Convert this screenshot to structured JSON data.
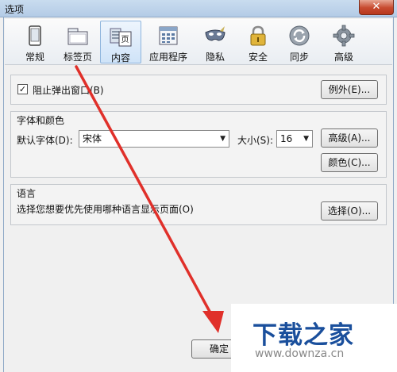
{
  "window": {
    "title": "选项",
    "close_label": "✕"
  },
  "tabs": [
    {
      "label": "常规",
      "icon": "general-icon",
      "selected": false
    },
    {
      "label": "标签页",
      "icon": "tabs-icon",
      "selected": false
    },
    {
      "label": "内容",
      "icon": "content-icon",
      "selected": true,
      "icon_text": "页"
    },
    {
      "label": "应用程序",
      "icon": "applications-icon",
      "selected": false
    },
    {
      "label": "隐私",
      "icon": "privacy-mask-icon",
      "selected": false
    },
    {
      "label": "安全",
      "icon": "security-lock-icon",
      "selected": false
    },
    {
      "label": "同步",
      "icon": "sync-icon",
      "selected": false
    },
    {
      "label": "高级",
      "icon": "advanced-gear-icon",
      "selected": false
    }
  ],
  "popups": {
    "checkbox_label": "阻止弹出窗口(B)",
    "checked": true,
    "exceptions_button": "例外(E)..."
  },
  "fonts": {
    "heading": "字体和颜色",
    "default_font_label": "默认字体(D):",
    "default_font_value": "宋体",
    "size_label": "大小(S):",
    "size_value": "16",
    "advanced_button": "高级(A)...",
    "colors_button": "颜色(C)..."
  },
  "language": {
    "heading": "语言",
    "description": "选择您想要优先使用哪种语言显示页面(O)",
    "choose_button": "选择(O)..."
  },
  "footer": {
    "ok_button": "确定"
  },
  "watermark": {
    "logo_text": "下载之家",
    "url": "www.downza.cn"
  },
  "colors": {
    "arrow": "#e0302a",
    "selected_tab": "#cfe3f8"
  }
}
